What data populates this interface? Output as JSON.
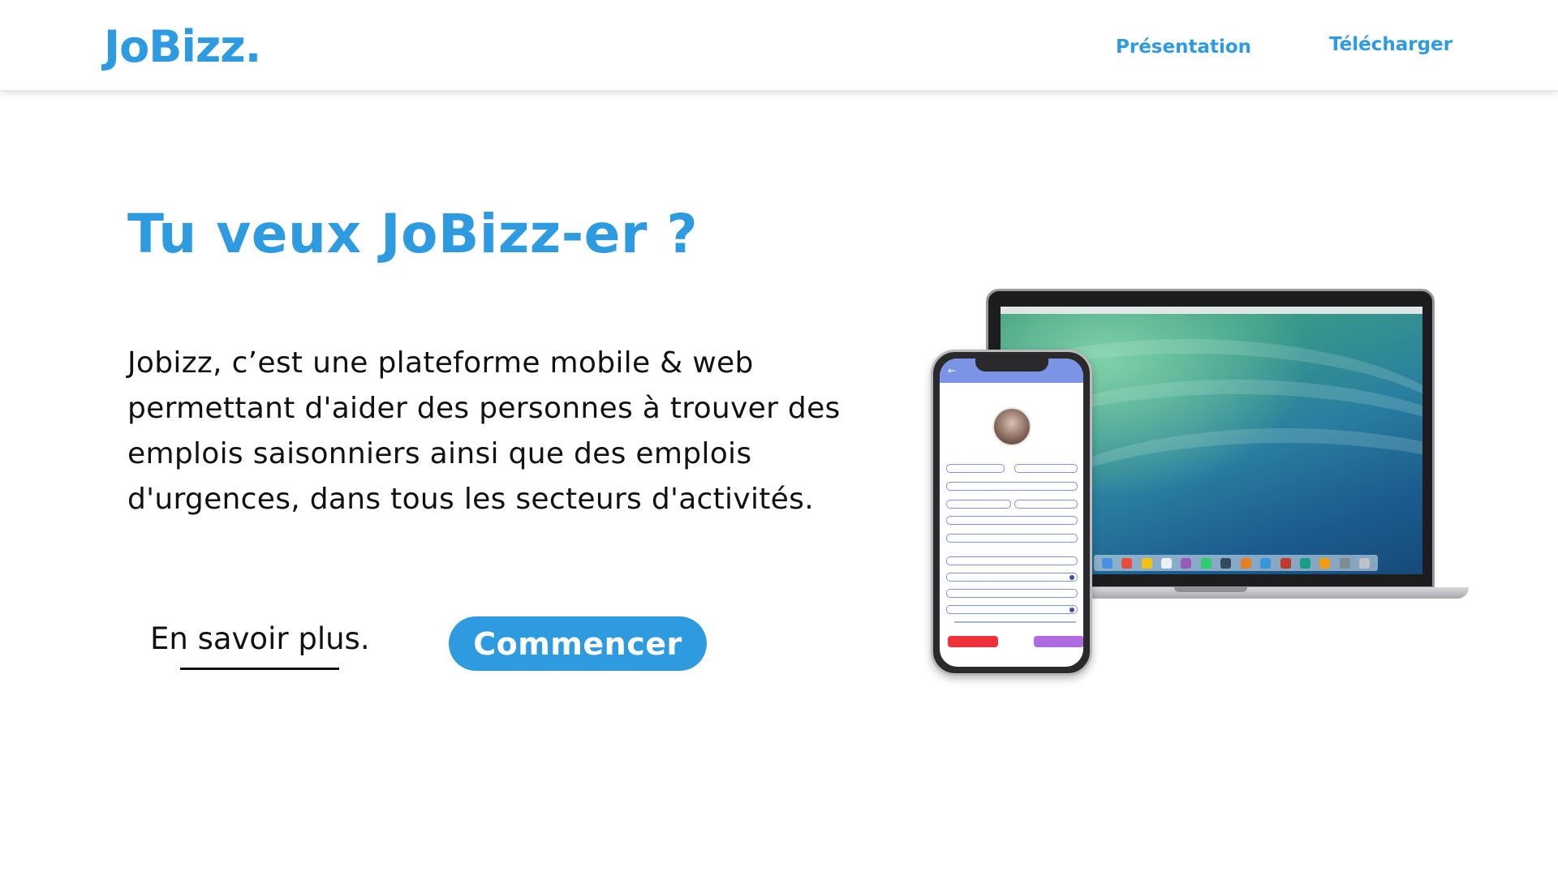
{
  "header": {
    "logo": "JoBizz.",
    "nav": [
      "Présentation",
      "Télécharger"
    ]
  },
  "hero": {
    "title": "Tu veux JoBizz-er ?",
    "description": "Jobizz, c’est une plateforme mobile & web permettant d'aider des personnes à trouver des emplois saisonniers ainsi que des emplois d'urgences, dans tous les secteurs d'activités.",
    "learn_more": "En savoir plus.",
    "cta": "Commencer"
  },
  "colors": {
    "accent": "#2e9be1",
    "text": "#111111",
    "background": "#ffffff"
  }
}
